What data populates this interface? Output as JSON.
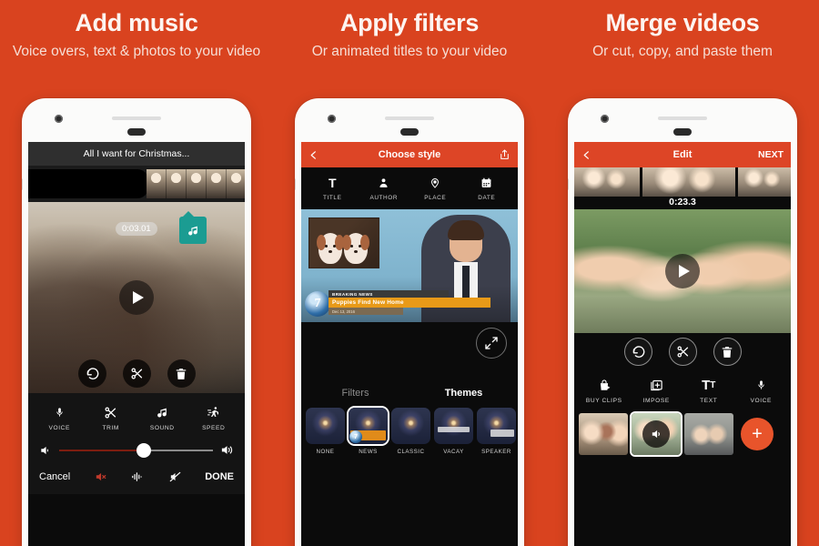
{
  "background_color": "#d9431f",
  "accent_color": "#dd4526",
  "panels": [
    {
      "heading": "Add music",
      "subheading": "Voice overs, text & photos to your video",
      "screen": {
        "project_title": "All I want for Christmas...",
        "timestamp": "0:03.01",
        "music_badge_icon": "music-note-icon",
        "play_icon": "play-icon",
        "circle_actions": [
          {
            "icon": "undo-icon",
            "name": "undo"
          },
          {
            "icon": "scissors-icon",
            "name": "cut"
          },
          {
            "icon": "trash-icon",
            "name": "delete"
          }
        ],
        "tools": [
          {
            "label": "VOICE",
            "icon": "microphone-icon"
          },
          {
            "label": "TRIM",
            "icon": "scissors-icon"
          },
          {
            "label": "SOUND",
            "icon": "music-note-icon"
          },
          {
            "label": "SPEED",
            "icon": "runner-icon"
          }
        ],
        "volume": {
          "low_icon": "volume-low-icon",
          "high_icon": "volume-high-icon",
          "value_percent": 55,
          "fill_color": "#7e1d10"
        },
        "footer": {
          "cancel_label": "Cancel",
          "done_label": "DONE",
          "mute_icon": "volume-mute-icon",
          "waveform_icon": "waveform-icon",
          "no-sound_icon": "sound-off-icon"
        }
      }
    },
    {
      "heading": "Apply filters",
      "subheading": "Or animated titles to your video",
      "screen": {
        "appbar": {
          "title": "Choose style",
          "back_icon": "chevron-left-icon",
          "share_icon": "share-icon"
        },
        "style_tabs": [
          {
            "label": "TITLE",
            "icon": "text-t-icon"
          },
          {
            "label": "AUTHOR",
            "icon": "person-icon"
          },
          {
            "label": "PLACE",
            "icon": "map-pin-icon"
          },
          {
            "label": "DATE",
            "icon": "calendar-icon"
          }
        ],
        "preview": {
          "channel_number": "7",
          "kicker": "BREAKING NEWS",
          "headline": "Puppies Find New Home",
          "date_line": "Dec 13, 2016"
        },
        "expand_icon": "expand-icon",
        "section_tabs": [
          {
            "label": "Filters",
            "active": false
          },
          {
            "label": "Themes",
            "active": true
          }
        ],
        "themes": [
          {
            "label": "NONE",
            "selected": false
          },
          {
            "label": "NEWS",
            "selected": true
          },
          {
            "label": "CLASSIC",
            "selected": false
          },
          {
            "label": "VACAY",
            "selected": false
          },
          {
            "label": "SPEAKER",
            "selected": false
          }
        ]
      }
    },
    {
      "heading": "Merge videos",
      "subheading": "Or cut, copy, and paste them",
      "screen": {
        "appbar": {
          "title": "Edit",
          "back_icon": "chevron-left-icon",
          "next_label": "NEXT"
        },
        "duration": "0:23.3",
        "play_icon": "play-icon",
        "circle_actions": [
          {
            "icon": "undo-icon",
            "name": "undo"
          },
          {
            "icon": "scissors-icon",
            "name": "cut"
          },
          {
            "icon": "trash-icon",
            "name": "delete"
          }
        ],
        "tools": [
          {
            "label": "BUY CLIPS",
            "icon": "shopping-bag-icon"
          },
          {
            "label": "IMPOSE",
            "icon": "add-layer-icon"
          },
          {
            "label": "TEXT",
            "icon": "text-tt-icon"
          },
          {
            "label": "VOICE",
            "icon": "microphone-icon"
          }
        ],
        "clips": [
          {
            "selected": false,
            "muted": false
          },
          {
            "selected": true,
            "muted": true
          },
          {
            "selected": false,
            "muted": false
          }
        ],
        "add_clip_label": "+"
      }
    }
  ]
}
